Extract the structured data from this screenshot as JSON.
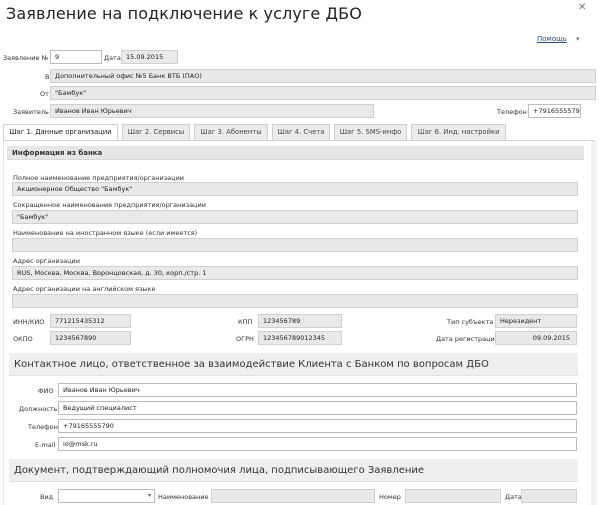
{
  "title": "Заявление на подключение к услуге ДБО",
  "help": "Помощь",
  "header": {
    "number_label": "Заявление №",
    "number_value": "9",
    "date_label": "Дата",
    "date_value": "15.09.2015",
    "to_label": "В",
    "to_value": "Дополнительный офис №5 Банк ВТБ (ПАО)",
    "from_label": "От",
    "from_value": "\"Бамбук\"",
    "applicant_label": "Заявитель",
    "applicant_value": "Иванов Иван Юрьевич",
    "phone_label": "Телефон",
    "phone_value": "+79165555790"
  },
  "tabs": [
    {
      "label": "Шаг 1. Данные организации"
    },
    {
      "label": "Шаг 2. Сервисы"
    },
    {
      "label": "Шаг 3. Абоненты"
    },
    {
      "label": "Шаг 4. Счета"
    },
    {
      "label": "Шаг 5. SMS-инфо"
    },
    {
      "label": "Шаг 6. Инд. настройки"
    }
  ],
  "bank_info": {
    "section_title": "Информация из банка",
    "full_name_label": "Полное наименование предприятия/организации",
    "full_name_value": "Акционерное Общество \"Бамбук\"",
    "short_name_label": "Сокращенное наименование предприятия/организации",
    "short_name_value": "\"Бамбук\"",
    "foreign_name_label": "Наименование на иностранном языке (если имеется)",
    "foreign_name_value": "",
    "address_label": "Адрес организации",
    "address_value": "RUS, Москва, Москва, Воронцовская, д. 30, корп./стр. 1",
    "address_en_label": "Адрес организации на английском языке",
    "address_en_value": "",
    "inn_label": "ИНН/КИО",
    "inn_value": "771215435312",
    "kpp_label": "КПП",
    "kpp_value": "123456789",
    "subject_type_label": "Тип субъекта",
    "subject_type_value": "Нерезидент",
    "okpo_label": "ОКПО",
    "okpo_value": "1234567890",
    "ogrn_label": "ОГРН",
    "ogrn_value": "123456789012345",
    "reg_date_label": "Дата регистрации",
    "reg_date_value": "09.09.2015"
  },
  "contact": {
    "section_title": "Контактное лицо, ответственное за взаимодействие Клиента с Банком по вопросам ДБО",
    "fio_label": "ФИО",
    "fio_value": "Иванов Иван Юрьевич",
    "position_label": "Должность",
    "position_value": "Ведущий специалист",
    "phone_label": "Телефон",
    "phone_value": "+79165555790",
    "email_label": "E-mail",
    "email_value": "io@msk.ru"
  },
  "document": {
    "section_title": "Документ, подтверждающий полномочия лица, подписывающего Заявление",
    "type_label": "Вид",
    "type_value": "",
    "name_label": "Наименование",
    "name_value": "",
    "number_label": "Номер",
    "number_value": "",
    "date_label": "Дата",
    "date_value": ""
  }
}
